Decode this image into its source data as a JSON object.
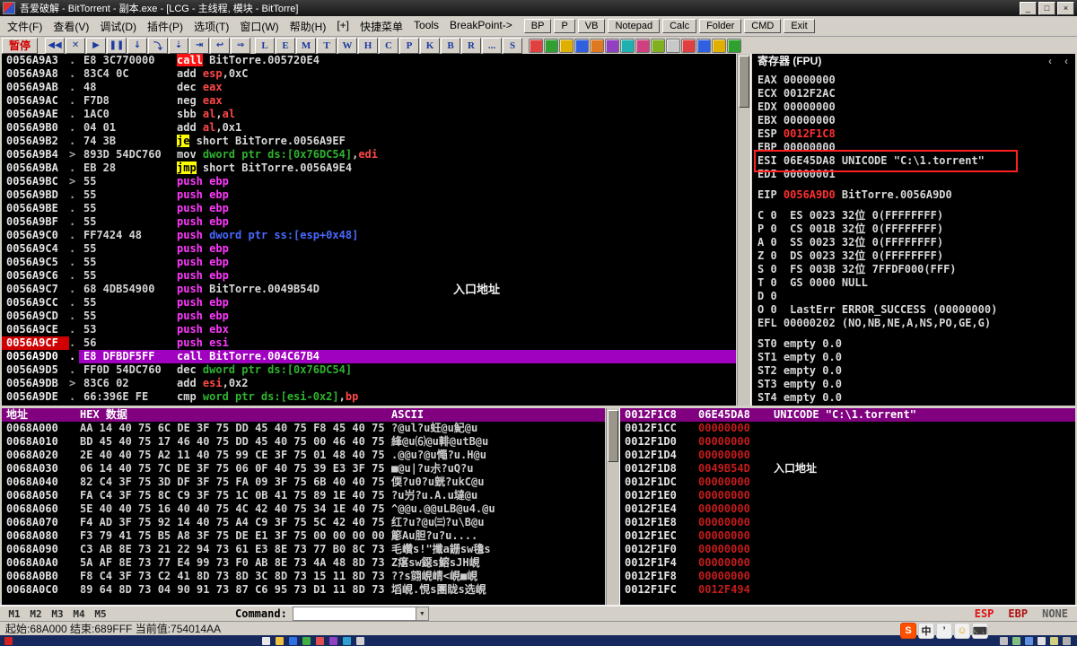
{
  "window": {
    "title": "吾爱破解 - BitTorrent - 副本.exe - [LCG -  主线程, 模块 - BitTorre]",
    "minimize": "_",
    "maximize": "□",
    "close": "×"
  },
  "menubar": {
    "items": [
      "文件(F)",
      "查看(V)",
      "调试(D)",
      "插件(P)",
      "选项(T)",
      "窗口(W)",
      "帮助(H)",
      "[+]",
      "快捷菜单",
      "Tools",
      "BreakPoint->"
    ],
    "buttons": [
      "BP",
      "P",
      "VB",
      "Notepad",
      "Calc",
      "Folder",
      "CMD",
      "Exit"
    ]
  },
  "toolbar": {
    "pause_label": "暂停",
    "buttons": [
      {
        "name": "restart-icon",
        "glyph": "◀◀"
      },
      {
        "name": "close-program-icon",
        "glyph": "✕"
      },
      {
        "name": "run-icon",
        "glyph": "▶"
      },
      {
        "name": "pause-icon",
        "glyph": "❚❚"
      },
      {
        "name": "step-into-icon",
        "glyph": "↓"
      },
      {
        "name": "step-over-icon",
        "glyph": "⤵"
      },
      {
        "name": "trace-into-icon",
        "glyph": "⇣"
      },
      {
        "name": "trace-over-icon",
        "glyph": "⇥"
      },
      {
        "name": "execute-till-return-icon",
        "glyph": "↩"
      },
      {
        "name": "go-to-address-icon",
        "glyph": "⇒"
      }
    ],
    "window_buttons": [
      "L",
      "E",
      "M",
      "T",
      "W",
      "H",
      "C",
      "P",
      "K",
      "B",
      "R",
      "...",
      "S"
    ],
    "plugin_colors": [
      "#e04040",
      "#30a030",
      "#e0b000",
      "#3060e0",
      "#e07820",
      "#9040c0",
      "#20b0b0",
      "#d04080",
      "#80b020",
      "#c8c8c8",
      "#e04040",
      "#3060e0",
      "#e0b000",
      "#30a030"
    ]
  },
  "disasm": {
    "rows": [
      {
        "addr": "0056A9A3",
        "mark": ".",
        "bytes": "E8 3C770000",
        "segs": [
          [
            "call",
            "hlr"
          ],
          [
            " BitTorre.005720E4",
            "w"
          ]
        ]
      },
      {
        "addr": "0056A9A8",
        "mark": ".",
        "bytes": "83C4 0C",
        "segs": [
          [
            "add ",
            "w"
          ],
          [
            "esp",
            "rg"
          ],
          [
            ",0xC",
            "w"
          ]
        ]
      },
      {
        "addr": "0056A9AB",
        "mark": ".",
        "bytes": "48",
        "segs": [
          [
            "dec ",
            "w"
          ],
          [
            "eax",
            "rg"
          ]
        ]
      },
      {
        "addr": "0056A9AC",
        "mark": ".",
        "bytes": "F7D8",
        "segs": [
          [
            "neg ",
            "w"
          ],
          [
            "eax",
            "rg"
          ]
        ]
      },
      {
        "addr": "0056A9AE",
        "mark": ".",
        "bytes": "1AC0",
        "segs": [
          [
            "sbb ",
            "w"
          ],
          [
            "al",
            "rg"
          ],
          [
            ",",
            "w"
          ],
          [
            "al",
            "rg"
          ]
        ]
      },
      {
        "addr": "0056A9B0",
        "mark": ".",
        "bytes": "04 01",
        "segs": [
          [
            "add ",
            "w"
          ],
          [
            "al",
            "rg"
          ],
          [
            ",0x1",
            "w"
          ]
        ]
      },
      {
        "addr": "0056A9B2",
        "mark": ".",
        "bytes": "74 3B",
        "segs": [
          [
            "je",
            "hly"
          ],
          [
            " short BitTorre.0056A9EF",
            "w"
          ]
        ]
      },
      {
        "addr": "0056A9B4",
        "mark": ">",
        "bytes": "893D 54DC760",
        "segs": [
          [
            "mov ",
            "w"
          ],
          [
            "dword ptr ds:[0x76DC54]",
            "gn"
          ],
          [
            ",",
            "w"
          ],
          [
            "edi",
            "rg"
          ]
        ]
      },
      {
        "addr": "0056A9BA",
        "mark": ".",
        "bytes": "EB 28",
        "segs": [
          [
            "jmp",
            "hly"
          ],
          [
            " short BitTorre.0056A9E4",
            "w"
          ]
        ]
      },
      {
        "addr": "0056A9BC",
        "mark": ">",
        "bytes": "55",
        "segs": [
          [
            "push ebp",
            "mg"
          ]
        ]
      },
      {
        "addr": "0056A9BD",
        "mark": ".",
        "bytes": "55",
        "segs": [
          [
            "push ebp",
            "mg"
          ]
        ]
      },
      {
        "addr": "0056A9BE",
        "mark": ".",
        "bytes": "55",
        "segs": [
          [
            "push ebp",
            "mg"
          ]
        ]
      },
      {
        "addr": "0056A9BF",
        "mark": ".",
        "bytes": "55",
        "segs": [
          [
            "push ebp",
            "mg"
          ]
        ]
      },
      {
        "addr": "0056A9C0",
        "mark": ".",
        "bytes": "FF7424 48",
        "segs": [
          [
            "push ",
            "mg"
          ],
          [
            "dword ptr ss:[esp+0x48]",
            "bl"
          ]
        ]
      },
      {
        "addr": "0056A9C4",
        "mark": ".",
        "bytes": "55",
        "segs": [
          [
            "push ebp",
            "mg"
          ]
        ]
      },
      {
        "addr": "0056A9C5",
        "mark": ".",
        "bytes": "55",
        "segs": [
          [
            "push ebp",
            "mg"
          ]
        ]
      },
      {
        "addr": "0056A9C6",
        "mark": ".",
        "bytes": "55",
        "segs": [
          [
            "push ebp",
            "mg"
          ]
        ]
      },
      {
        "addr": "0056A9C7",
        "mark": ".",
        "bytes": "68 4DB54900",
        "segs": [
          [
            "push ",
            "mg"
          ],
          [
            "BitTorre.0049B54D",
            "w"
          ]
        ],
        "com": "入口地址"
      },
      {
        "addr": "0056A9CC",
        "mark": ".",
        "bytes": "55",
        "segs": [
          [
            "push ebp",
            "mg"
          ]
        ]
      },
      {
        "addr": "0056A9CD",
        "mark": ".",
        "bytes": "55",
        "segs": [
          [
            "push ebp",
            "mg"
          ]
        ]
      },
      {
        "addr": "0056A9CE",
        "mark": ".",
        "bytes": "53",
        "segs": [
          [
            "push ebx",
            "mg"
          ]
        ]
      },
      {
        "addr": "0056A9CF",
        "mark": ".",
        "bytes": "56",
        "addrCls": "bp",
        "segs": [
          [
            "push esi",
            "mg"
          ]
        ]
      },
      {
        "addr": "0056A9D0",
        "mark": ".",
        "bytes": "E8 DFBDF5FF",
        "sel": true,
        "segs": [
          [
            "call BitTorre.004C67B4",
            "w"
          ]
        ]
      },
      {
        "addr": "0056A9D5",
        "mark": ".",
        "bytes": "FF0D 54DC760",
        "segs": [
          [
            "dec ",
            "w"
          ],
          [
            "dword ptr ds:[0x76DC54]",
            "gn"
          ]
        ]
      },
      {
        "addr": "0056A9DB",
        "mark": ">",
        "bytes": "83C6 02",
        "segs": [
          [
            "add ",
            "w"
          ],
          [
            "esi",
            "rg"
          ],
          [
            ",0x2",
            "w"
          ]
        ]
      },
      {
        "addr": "0056A9DE",
        "mark": ".",
        "bytes": "66:396E FE",
        "segs": [
          [
            "cmp ",
            "w"
          ],
          [
            "word ptr ds:[esi-0x2]",
            "gn"
          ],
          [
            ",",
            "w"
          ],
          [
            "bp",
            "rg"
          ]
        ]
      }
    ]
  },
  "registers": {
    "title": "寄存器 (FPU)",
    "lines": [
      [
        [
          "EAX 00000000",
          "w"
        ]
      ],
      [
        [
          "ECX 0012F2AC",
          "w"
        ]
      ],
      [
        [
          "EDX 00000000",
          "w"
        ]
      ],
      [
        [
          "EBX 00000000",
          "w"
        ]
      ],
      [
        [
          "ESP ",
          "w"
        ],
        [
          "0012F1C8",
          "r"
        ]
      ],
      [
        [
          "EBP 00000000",
          "w"
        ]
      ],
      [
        [
          "ESI 06E45DA8 UNICODE \"C:\\1.torrent\"",
          "w"
        ]
      ],
      [
        [
          "EDI 00000001",
          "w"
        ]
      ],
      [],
      [
        [
          "EIP ",
          "w"
        ],
        [
          "0056A9D0",
          "r"
        ],
        [
          " BitTorre.0056A9D0",
          "w"
        ]
      ],
      [],
      [
        [
          "C 0  ES 0023 32位 0(FFFFFFFF)",
          "w"
        ]
      ],
      [
        [
          "P 0  CS 001B 32位 0(FFFFFFFF)",
          "w"
        ]
      ],
      [
        [
          "A 0  SS 0023 32位 0(FFFFFFFF)",
          "w"
        ]
      ],
      [
        [
          "Z 0  DS 0023 32位 0(FFFFFFFF)",
          "w"
        ]
      ],
      [
        [
          "S 0  FS 003B 32位 7FFDF000(FFF)",
          "w"
        ]
      ],
      [
        [
          "T 0  GS 0000 NULL",
          "w"
        ]
      ],
      [
        [
          "D 0",
          "w"
        ]
      ],
      [
        [
          "O 0  LastErr ERROR_SUCCESS (00000000)",
          "w"
        ]
      ],
      [
        [
          "EFL 00000202 (NO,NB,NE,A,NS,PO,GE,G)",
          "w"
        ]
      ],
      [],
      [
        [
          "ST0 empty 0.0",
          "w"
        ]
      ],
      [
        [
          "ST1 empty 0.0",
          "w"
        ]
      ],
      [
        [
          "ST2 empty 0.0",
          "w"
        ]
      ],
      [
        [
          "ST3 empty 0.0",
          "w"
        ]
      ],
      [
        [
          "ST4 empty 0.0",
          "w"
        ]
      ]
    ]
  },
  "dump": {
    "headers": {
      "addr": "地址",
      "hex": "HEX 数据",
      "ascii": "ASCII"
    },
    "rows": [
      {
        "addr": "0068A000",
        "hex": "AA 14 40 75 6C DE 3F 75 DD 45 40 75 F8 45 40 75",
        "ascii": "?@ul?u蚟@u魢@u"
      },
      {
        "addr": "0068A010",
        "hex": "BD 45 40 75 17 46 40 75 DD 45 40 75 00 46 40 75",
        "ascii": "綘@u⑹@u輫@utB@u"
      },
      {
        "addr": "0068A020",
        "hex": "2E 40 40 75 A2 11 40 75 99 CE 3F 75 01 48 40 75",
        "ascii": ".@@u?@u憴?u.H@u"
      },
      {
        "addr": "0068A030",
        "hex": "06 14 40 75 7C DE 3F 75 06 0F 40 75 39 E3 3F 75",
        "ascii": "■@u|?u尗?uQ?u"
      },
      {
        "addr": "0068A040",
        "hex": "82 C4 3F 75 3D DF 3F 75 FA 09 3F 75 6B 40 40 75",
        "ascii": "偄?u0?u皝?ukC@u"
      },
      {
        "addr": "0068A050",
        "hex": "FA C4 3F 75 8C C9 3F 75 1C 0B 41 75 89 1E 40 75",
        "ascii": "?u屶?u.A.u墶@u"
      },
      {
        "addr": "0068A060",
        "hex": "5E 40 40 75 16 40 40 75 4C 42 40 75 34 1E 40 75",
        "ascii": "^@@u.@@uLB@u4.@u"
      },
      {
        "addr": "0068A070",
        "hex": "F4 AD 3F 75 92 14 40 75 A4 C9 3F 75 5C 42 40 75",
        "ascii": "红?u?@u㈢?u\\B@u"
      },
      {
        "addr": "0068A080",
        "hex": "F3 79 41 75 B5 A8 3F 75 DE E1 3F 75 00 00 00 00",
        "ascii": "簓Au胆?u?u...."
      },
      {
        "addr": "0068A090",
        "hex": "C3 AB 8E 73 21 22 94 73 61 E3 8E 73 77 B0 8C 73",
        "ascii": "毛巑s!\"攕a銏sw氌s"
      },
      {
        "addr": "0068A0A0",
        "hex": "5A AF 8E 73 77 E4 99 73 F0 AB 8E 73 4A 48 8D 73",
        "ascii": "Z瘎sw鐚s鰫sJH峴"
      },
      {
        "addr": "0068A0B0",
        "hex": "F8 C4 3F 73 C2 41 8D 73 8D 3C 8D 73 15 11 8D 73",
        "ascii": "??s翧峴崝<峴■峴"
      },
      {
        "addr": "0068A0C0",
        "hex": "89 64 8D 73 04 90 91 73 87 C6 95 73 D1 11 8D 73",
        "ascii": "塪峴.悓s團眬s选峴"
      }
    ]
  },
  "stack": {
    "rows": [
      {
        "addr": "0012F1C8",
        "val": "06E45DA8",
        "com": "UNICODE \"C:\\1.torrent\"",
        "sel": true
      },
      {
        "addr": "0012F1CC",
        "val": "00000000"
      },
      {
        "addr": "0012F1D0",
        "val": "00000000"
      },
      {
        "addr": "0012F1D4",
        "val": "00000000"
      },
      {
        "addr": "0012F1D8",
        "val": "0049B54D",
        "com": "入口地址"
      },
      {
        "addr": "0012F1DC",
        "val": "00000000"
      },
      {
        "addr": "0012F1E0",
        "val": "00000000"
      },
      {
        "addr": "0012F1E4",
        "val": "00000000"
      },
      {
        "addr": "0012F1E8",
        "val": "00000000"
      },
      {
        "addr": "0012F1EC",
        "val": "00000000"
      },
      {
        "addr": "0012F1F0",
        "val": "00000000"
      },
      {
        "addr": "0012F1F4",
        "val": "00000000"
      },
      {
        "addr": "0012F1F8",
        "val": "00000000"
      },
      {
        "addr": "0012F1FC",
        "val": "0012F494"
      }
    ]
  },
  "commandbar": {
    "tabs": [
      "M1",
      "M2",
      "M3",
      "M4",
      "M5"
    ],
    "label": "Command:",
    "dropdown_icon": "▼",
    "indicators": [
      "ESP",
      "EBP",
      "NONE"
    ]
  },
  "statusbar": {
    "text": "起始:68A000 结束:689FFF 当前值:754014AA"
  },
  "registers_nav": {
    "prev": "‹",
    "next": "‹"
  },
  "taskbar": {
    "left_icons": [
      "#d42020"
    ],
    "app_icons": [
      "#e8e8e8",
      "#f0c040",
      "#3070e0",
      "#40b040",
      "#e05050",
      "#9040c0",
      "#30a0d0",
      "#d0d0d0"
    ],
    "tray_icons": [
      "#c0c0c0",
      "#80c080",
      "#6090e0",
      "#e0e0e0",
      "#d0d080",
      "#b0b0b0"
    ],
    "ime": [
      {
        "t": "S",
        "bg": "#ff5000",
        "c": "#ffffff"
      },
      {
        "t": "中",
        "bg": "#f0f0f0",
        "c": "#202020"
      },
      {
        "t": "’",
        "bg": "#f0f0f0",
        "c": "#202020"
      },
      {
        "t": "☺",
        "bg": "#f0f0f0",
        "c": "#e0a000"
      },
      {
        "t": "⌨",
        "bg": "#f0f0f0",
        "c": "#303030"
      }
    ]
  },
  "colors": {
    "selection_purple": "#a000c0",
    "header_purple": "#800080",
    "annotation_red": "#ff2020",
    "stack_value_red": "#c41c1c"
  }
}
